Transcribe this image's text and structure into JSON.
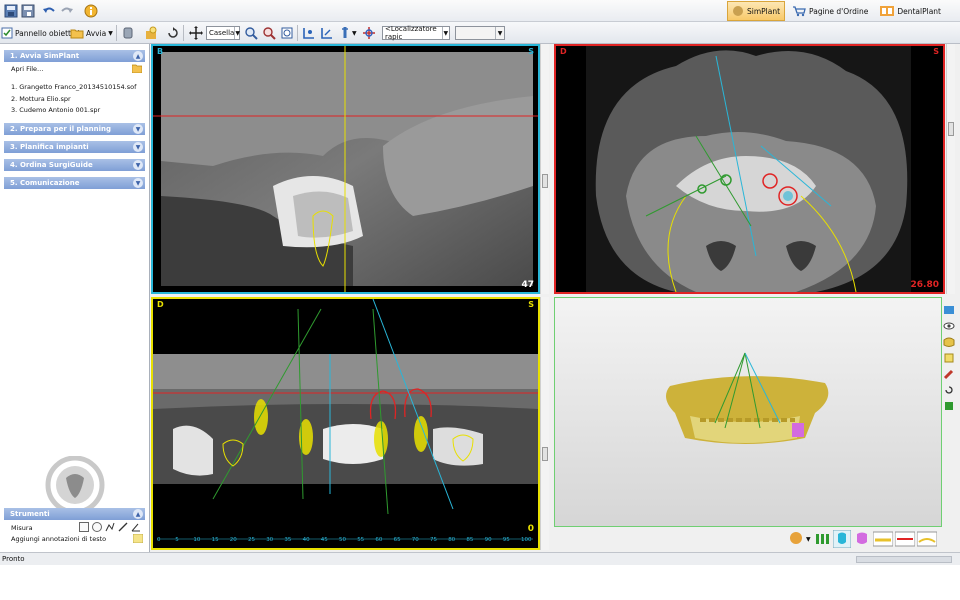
{
  "mode_tabs": [
    {
      "label": "SimPlant",
      "active": true
    },
    {
      "label": "Pagine d'Ordine",
      "active": false
    },
    {
      "label": "DentalPlant",
      "active": false
    }
  ],
  "toolbar": {
    "objectives_panel": "Pannello obiettivi",
    "start": "Avvia",
    "box_select": "Casella",
    "locator_select": "<Localizzatore rapic"
  },
  "left_panel": {
    "groups": [
      {
        "label": "1. Avvia SimPlant"
      },
      {
        "label": "2. Prepara per il planning"
      },
      {
        "label": "3. Planifica impianti"
      },
      {
        "label": "4. Ordina SurgiGuide"
      },
      {
        "label": "5. Comunicazione"
      }
    ],
    "open_file": "Apri File…",
    "recent_files": [
      "1. Grangetto Franco_20134510154.sof",
      "2. Mottura Elio.spr",
      "3. Cudemo Antonio 001.spr"
    ],
    "logo_text": "SimPlant",
    "tools_header": "Strumenti",
    "measure": "Misura",
    "annotations": "Aggiungi annotazioni di testo"
  },
  "viewports": {
    "sagittal": {
      "left_label": "B",
      "right_label": "S",
      "slice": "47"
    },
    "axial": {
      "left_label": "D",
      "right_label": "S",
      "slice": "26.80"
    },
    "panoramic": {
      "left_label": "D",
      "right_label": "S",
      "slice": "0",
      "ruler": [
        "0",
        "5",
        "10",
        "15",
        "20",
        "25",
        "30",
        "35",
        "40",
        "45",
        "50",
        "55",
        "60",
        "65",
        "70",
        "75",
        "80",
        "85",
        "90",
        "95",
        "100"
      ]
    },
    "implants": [
      "1",
      "2",
      "3",
      "4"
    ]
  },
  "status": {
    "text": "Pronto"
  },
  "colors": {
    "sagittal_border": "#29b6d8",
    "axial_border": "#e02424",
    "panoramic_border": "#e8e000",
    "model_border": "#6fcf72",
    "group_header": "#7f9fd6"
  }
}
